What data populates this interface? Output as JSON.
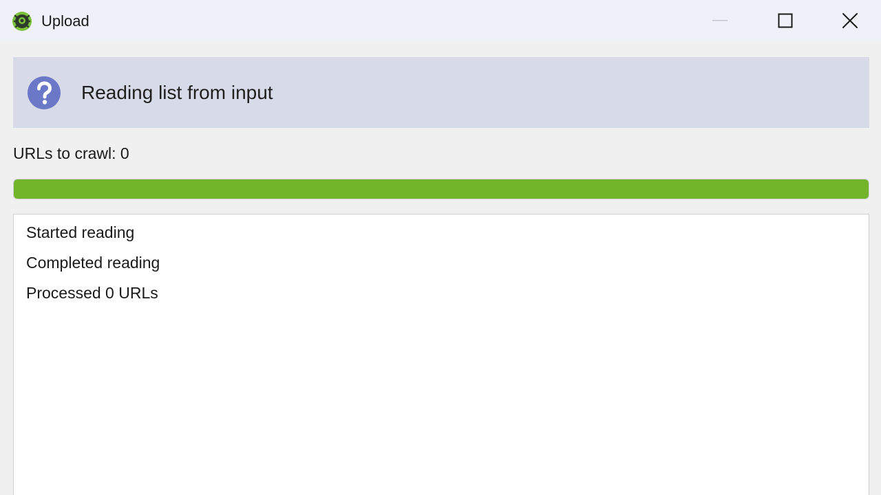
{
  "window": {
    "title": "Upload",
    "icons": {
      "app": "spider-icon",
      "minimize": "minimize-icon",
      "maximize": "maximize-icon",
      "close": "close-icon"
    }
  },
  "banner": {
    "icon": "question-icon",
    "message": "Reading list from input"
  },
  "status": {
    "urls_label": "URLs to crawl: 0"
  },
  "progress": {
    "fraction": 1.0,
    "color": "#72b52a"
  },
  "log": {
    "lines": [
      "Started reading",
      "Completed reading",
      "Processed 0 URLs"
    ]
  },
  "colors": {
    "titlebar": "#eef1f7",
    "banner": "#d7dbe7",
    "question_icon": "#6b78c8",
    "accent_green": "#72b52a"
  }
}
